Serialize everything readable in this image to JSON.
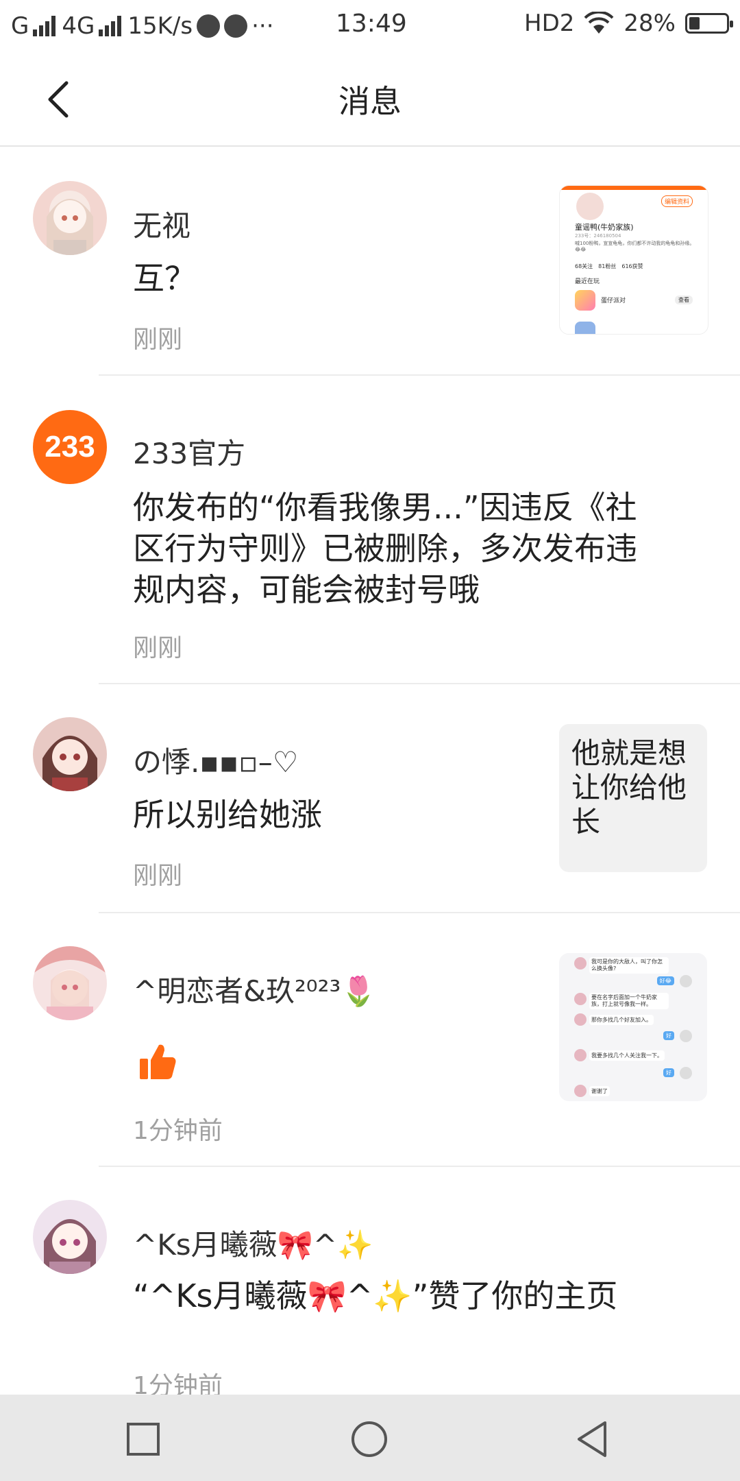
{
  "status_bar": {
    "carrier1": "G",
    "carrier2": "4G",
    "speed": "15K/s",
    "more": "···",
    "time": "13:49",
    "hd": "HD2",
    "battery": "28%",
    "battery_level": 0.28
  },
  "header": {
    "title": "消息"
  },
  "messages": [
    {
      "name": "无视",
      "text": "互？",
      "time": "刚刚"
    },
    {
      "name": "233官方",
      "avatar_text": "233",
      "text": "你发布的“你看我像男...”因违反《社区行为守则》已被删除，多次发布违规内容，可能会被封号哦",
      "time": "刚刚"
    },
    {
      "name": "の悸.▪▪▫–♡",
      "text": "所以别给她涨",
      "time": "刚刚",
      "quote": "他就是想让你给他长"
    },
    {
      "name": "^明恋者&玖²⁰²³🌷",
      "time": "1分钟前"
    },
    {
      "name": "^Ks月曦薇🎀^✨",
      "text": "“^Ks月曦薇🎀^✨”赞了你的主页",
      "time": "1分钟前"
    }
  ],
  "thumb1": {
    "tab": "编辑资料",
    "name": "童谣鸭(牛奶家族)",
    "id": "233号：246180504",
    "bio": "喊100粉鸭，宣宣龟龟，你们都不许动我的龟龟和孙缘。😂😂",
    "stats": "68关注　81粉丝　616获赞",
    "section": "最近在玩",
    "game": "蛋仔派对",
    "btn": "查看"
  },
  "thumb2": {
    "lines": [
      "我可是你的大敌人，叫了你怎么换头像?",
      "好😂",
      "要在名字后面加一个牛奶家族，打上就号像我一样。",
      "那你多找几个好友加入。",
      "好",
      "我要多找几个人关注我一下。",
      "好",
      "谢谢了"
    ]
  },
  "nav": {
    "square": "square-icon",
    "circle": "circle-icon",
    "back": "triangle-back-icon"
  }
}
